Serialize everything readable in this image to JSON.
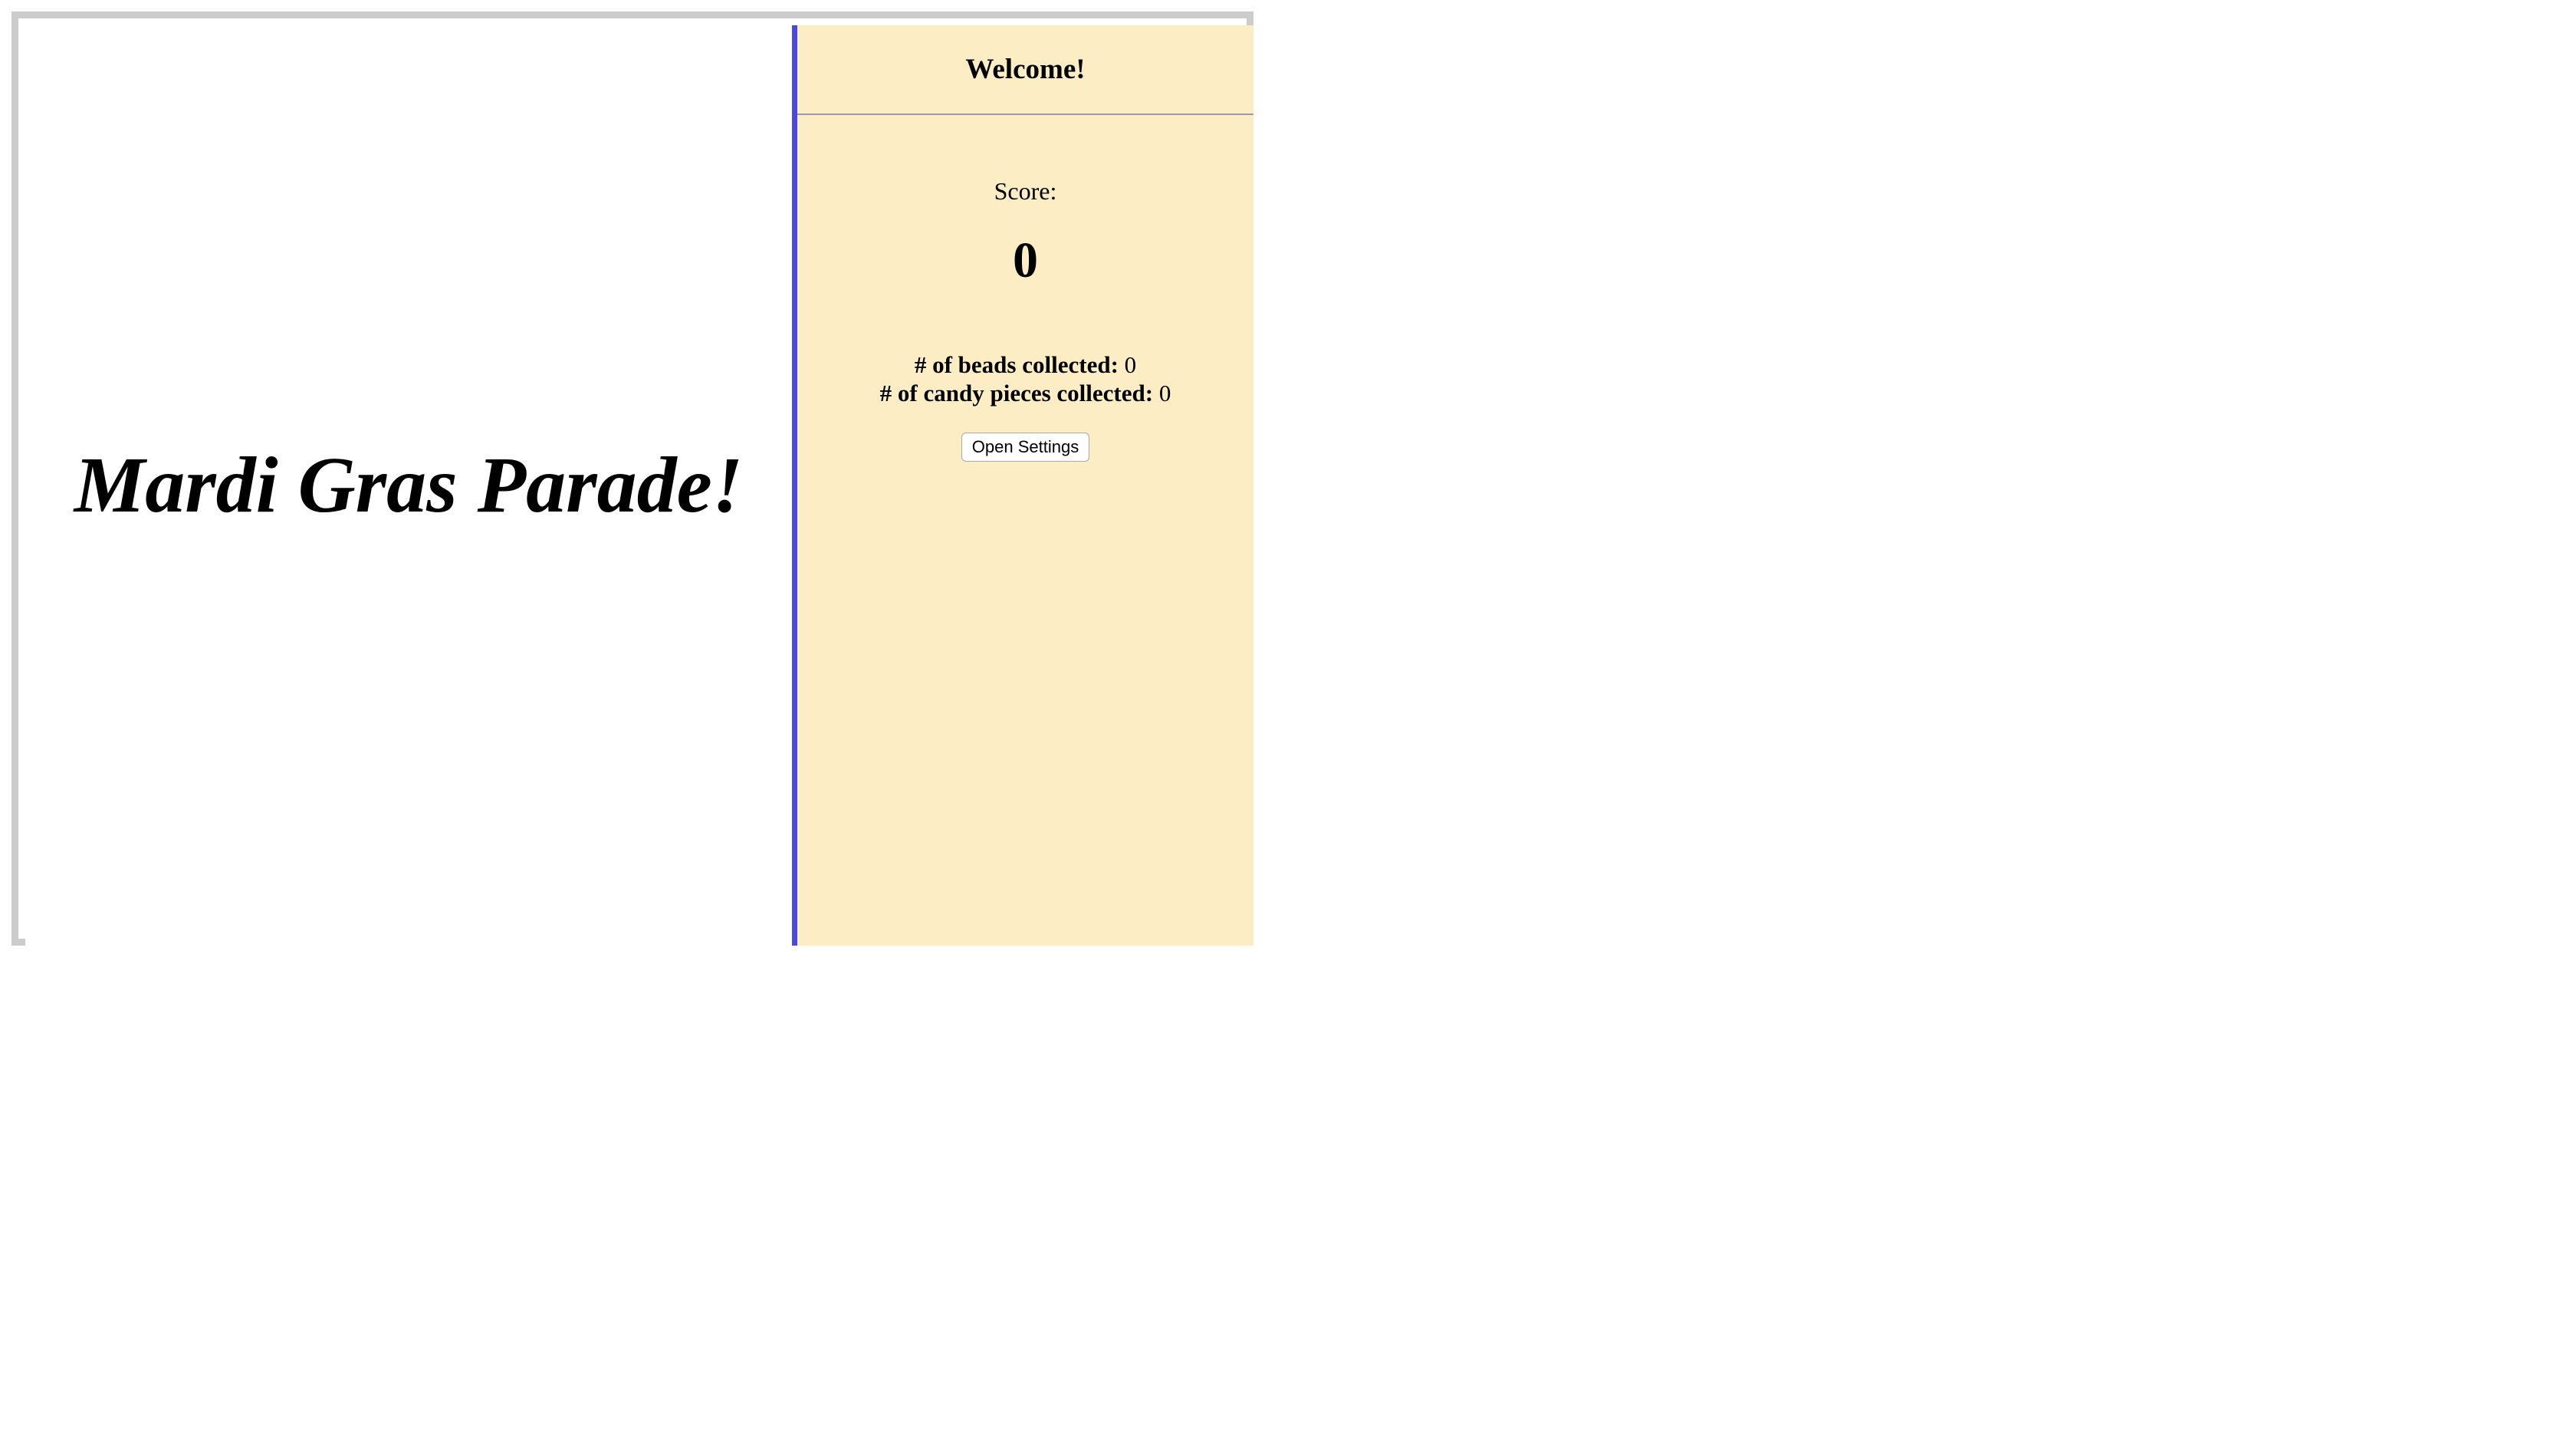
{
  "stage": {
    "title": "Mardi Gras Parade!"
  },
  "panel": {
    "header": "Welcome!",
    "score_label": "Score:",
    "score_value": "0",
    "stats": [
      {
        "label": "# of beads collected:",
        "value": "0"
      },
      {
        "label": "# of candy pieces collected:",
        "value": "0"
      }
    ],
    "settings_button": "Open Settings"
  },
  "colors": {
    "frame_border": "#cccccc",
    "divider": "#4a47e0",
    "panel_background": "#fcedc4",
    "stage_background": "#ffffff"
  }
}
